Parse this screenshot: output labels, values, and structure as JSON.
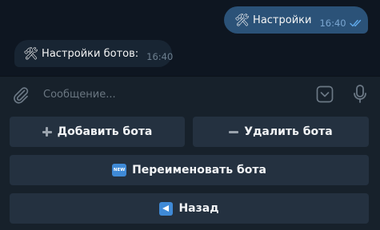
{
  "chat": {
    "outgoing": {
      "emoji": "🛠",
      "text": "Настройки",
      "time": "16:40"
    },
    "incoming": {
      "emoji": "🛠",
      "text": "Настройки ботов:",
      "time": "16:40"
    }
  },
  "composer": {
    "placeholder": "Сообщение..."
  },
  "keyboard": {
    "add_label": "Добавить бота",
    "remove_label": "Удалить бота",
    "rename_label": "Переименовать бота",
    "rename_icon_text": "NEW",
    "back_label": "Назад"
  },
  "colors": {
    "background": "#0e1621",
    "outgoing_bubble": "#2b5278",
    "incoming_bubble": "#182533",
    "panel": "#17212b",
    "button": "#243140",
    "accent": "#3f8ad7"
  },
  "icons": {
    "attach": "paperclip-icon",
    "keyboard_toggle": "chevron-down-icon",
    "voice": "microphone-icon",
    "read_status": "double-check-icon"
  }
}
